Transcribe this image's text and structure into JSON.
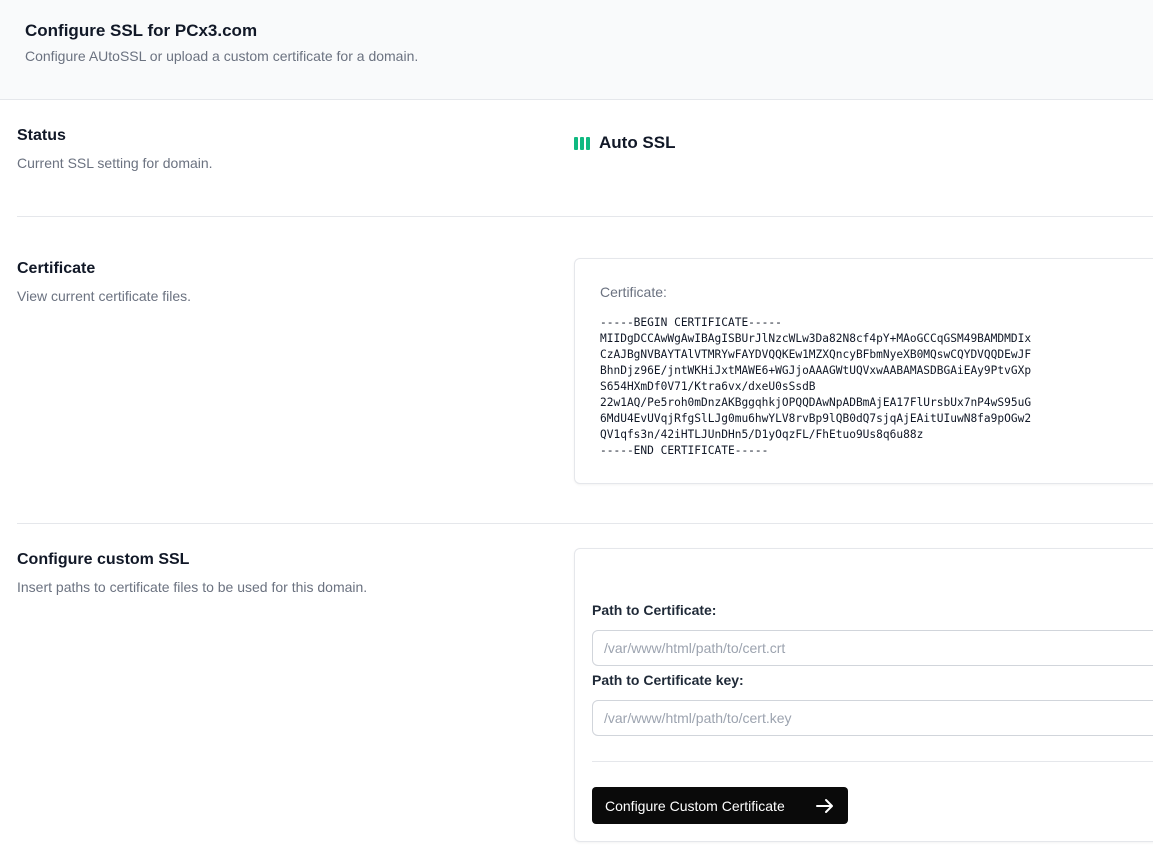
{
  "header": {
    "title": "Configure SSL for PCx3.com",
    "subtitle": "Configure AUtoSSL or upload a custom certificate for a domain."
  },
  "status": {
    "title": "Status",
    "description": "Current SSL setting for domain.",
    "value": "Auto SSL",
    "icon": "signal-bars-icon",
    "accent_color": "#10b981"
  },
  "certificate": {
    "title": "Certificate",
    "description": "View current certificate files.",
    "label": "Certificate:",
    "content": "-----BEGIN CERTIFICATE-----\nMIIDgDCCAwWgAwIBAgISBUrJlNzcWLw3Da82N8cf4pY+MAoGCCqGSM49BAMDMDIx\nCzAJBgNVBAYTAlVTMRYwFAYDVQQKEw1MZXQncyBFbmNyeXB0MQswCQYDVQQDEwJF\nBhnDjz96E/jntWKHiJxtMAWE6+WGJjoAAAGWtUQVxwAABAMASDBGAiEAy9PtvGXp\nS654HXmDf0V71/Ktra6vx/dxeU0sSsdB\n22w1AQ/Pe5roh0mDnzAKBggqhkjOPQQDAwNpADBmAjEA17FlUrsbUx7nP4wS95uG\n6MdU4EvUVqjRfgSlLJg0mu6hwYLV8rvBp9lQB0dQ7sjqAjEAitUIuwN8fa9pOGw2\nQV1qfs3n/42iHTLJUnDHn5/D1yOqzFL/FhEtuo9Us8q6u88z\n-----END CERTIFICATE-----"
  },
  "custom_ssl": {
    "title": "Configure custom SSL",
    "description": "Insert paths to certificate files to be used for this domain.",
    "cert_path_label": "Path to Certificate:",
    "cert_path_value": "",
    "cert_path_placeholder": "/var/www/html/path/to/cert.crt",
    "key_path_label": "Path to Certificate key:",
    "key_path_value": "",
    "key_path_placeholder": "/var/www/html/path/to/cert.key",
    "submit_label": "Configure Custom Certificate",
    "submit_icon": "arrow-right-icon"
  }
}
